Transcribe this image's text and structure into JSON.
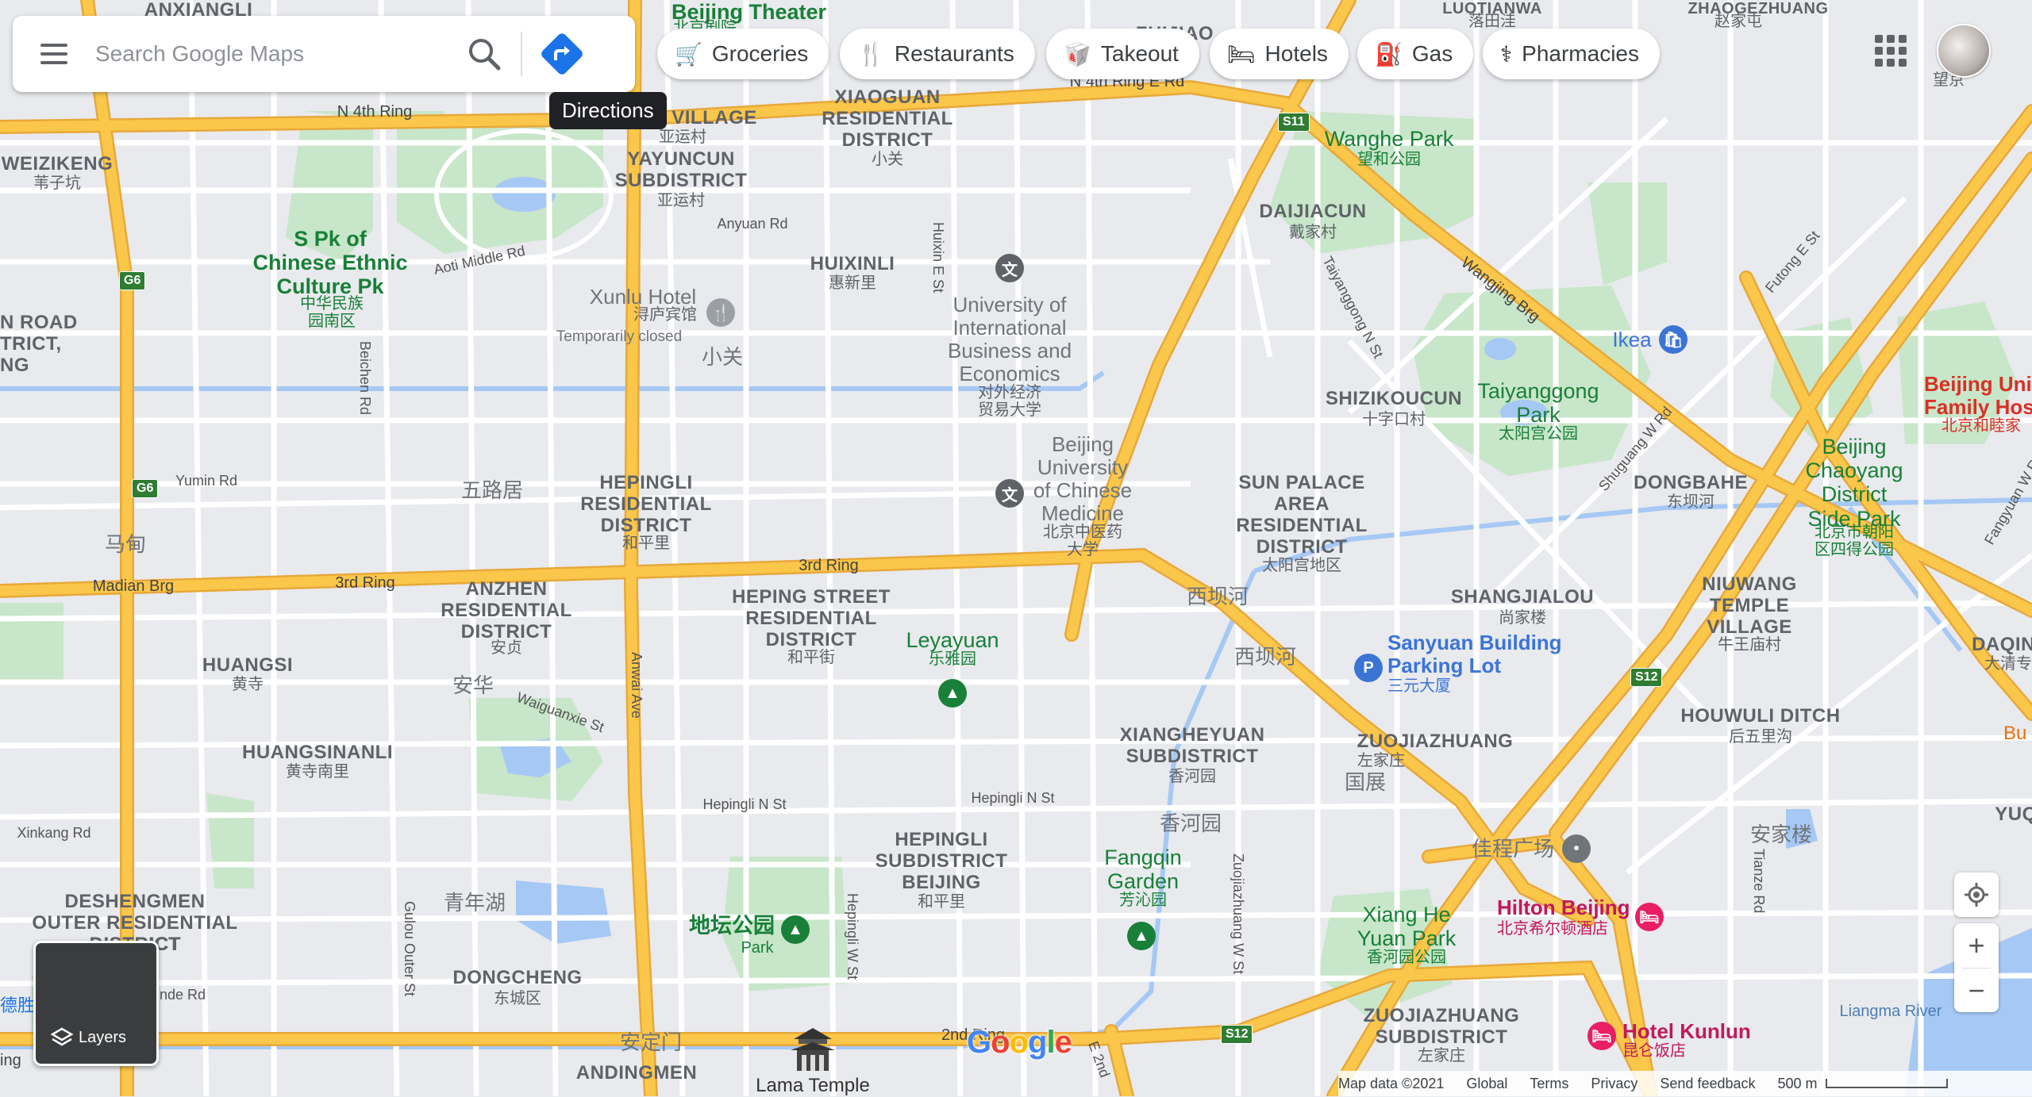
{
  "search": {
    "placeholder": "Search Google Maps"
  },
  "tooltip": {
    "directions": "Directions"
  },
  "chips": [
    {
      "icon": "cart-icon",
      "glyph": "🛒",
      "label": "Groceries"
    },
    {
      "icon": "fork-knife-icon",
      "glyph": "🍴",
      "label": "Restaurants"
    },
    {
      "icon": "takeout-icon",
      "glyph": "🥡",
      "label": "Takeout"
    },
    {
      "icon": "bed-icon",
      "glyph": "🛏",
      "label": "Hotels"
    },
    {
      "icon": "gas-pump-icon",
      "glyph": "⛽",
      "label": "Gas"
    },
    {
      "icon": "pharmacy-icon",
      "glyph": "⚕",
      "label": "Pharmacies"
    }
  ],
  "layers": {
    "label": "Layers"
  },
  "footer": {
    "map_data": "Map data ©2021",
    "global": "Global",
    "terms": "Terms",
    "privacy": "Privacy",
    "feedback": "Send feedback",
    "scale": "500 m"
  },
  "logo": "Google",
  "colors": {
    "road_major": "#fbc74a",
    "road_major_edge": "#e8a83a",
    "park": "#c8e6c9",
    "water": "#a6c8f5",
    "background": "#e8eaed",
    "highway_shield": "#2e7d32"
  },
  "labels": {
    "anxiangli": "ANXIANGLI",
    "beijing_theater": "Beijing Theater",
    "beijing_theater_zh": "北京剧院",
    "zhijiao": "ZHIJIAO",
    "luotianwa": "LUOTIANWA",
    "luotianwa_zh": "落田洼",
    "zhaogezhuang": "ZHAOGEZHUANG",
    "zhaogezhuang_zh": "赵家屯",
    "wangjing_zh": "望京",
    "n4th_ring_left": "N 4th Ring",
    "n4th_ring_right": "N 4th Ring E Rd",
    "yayuncun_village": "VILLAGE",
    "yayuncun_village_zh": "亚运村",
    "yayuncun": "YAYUNCUN\nSUBDISTRICT",
    "yayuncun_zh": "亚运村",
    "xiaoguan": "XIAOGUAN\nRESIDENTIAL\nDISTRICT",
    "xiaoguan_zh": "小关",
    "weizikeng": "WEIZIKENG",
    "weizikeng_zh": "苇子坑",
    "wanghe_park": "Wanghe Park",
    "wanghe_park_zh": "望和公园",
    "daijiacun": "DAIJIACUN",
    "daijiacun_zh": "戴家村",
    "culture_park": "S Pk of\nChinese Ethnic\nCulture Pk",
    "culture_park_zh": "中华民族\n园南区",
    "aoti_rd": "Aoti Middle Rd",
    "anyuan_rd": "Anyuan Rd",
    "huixinli": "HUIXINLI",
    "huixinli_zh": "惠新里",
    "huixin_e_st": "Huixin E St",
    "uibe": "University of\nInternational\nBusiness and\nEconomics",
    "uibe_zh": "对外经济\n贸易大学",
    "xunlu_hotel": "Xunlu Hotel",
    "xunlu_hotel_zh": "浔庐宾馆",
    "temporarily_closed": "Temporarily closed",
    "xiaoguan_zh2": "小关",
    "north_road": "N ROAD\nTRICT,\nNG",
    "beichen_rd": "Beichen Rd",
    "taiyanggong_n_st": "Taiyanggong N St",
    "wangjing_brg": "Wangjing Brg",
    "futong_e_st": "Futong E St",
    "ikea": "Ikea",
    "shizikoucun": "SHIZIKOUCUN",
    "shizikoucun_zh": "十字口村",
    "taiyanggong_park": "Taiyanggong\nPark",
    "taiyanggong_park_zh": "太阳宫公园",
    "beijing_united": "Beijing Uni\nFamily Hosp",
    "beijing_united_zh": "北京和睦家",
    "yumin_rd": "Yumin Rd",
    "wuluju_zh": "五路居",
    "hepingli": "HEPINGLI\nRESIDENTIAL\nDISTRICT",
    "hepingli_zh": "和平里",
    "bucm": "Beijing\nUniversity\nof Chinese\nMedicine",
    "bucm_zh": "北京中医药\n大学",
    "sun_palace": "SUN PALACE\nAREA\nRESIDENTIAL\nDISTRICT",
    "sun_palace_zh": "太阳宫地区",
    "shuguang_w_rd": "Shuguang W Rd",
    "dongbahe": "DONGBAHE",
    "dongbahe_zh": "东坝河",
    "chaoyang_side_park": "Beijing\nChaoyang\nDistrict\nSide Park",
    "chaoyang_side_park_zh": "北京市朝阳\n区四得公园",
    "fangyuan_w_rd": "Fangyuan W Rd",
    "madian_zh": "马甸",
    "madian_brg": "Madian Brg",
    "third_ring_left": "3rd Ring",
    "third_ring_mid": "3rd Ring",
    "anzhen": "ANZHEN\nRESIDENTIAL\nDISTRICT",
    "anzhen_zh": "安贞",
    "heping_street": "HEPING STREET\nRESIDENTIAL\nDISTRICT",
    "heping_street_zh": "和平街",
    "xibahe_zh": "西坝河",
    "xibahe_zh2": "西坝河",
    "shangjialou": "SHANGJIALOU",
    "shangjialou_zh": "尚家楼",
    "niuwang": "NIUWANG\nTEMPLE\nVILLAGE",
    "niuwang_zh": "牛王庙村",
    "leyayuan": "Leyayuan",
    "leyayuan_zh": "乐雅园",
    "sanyuan_parking": "Sanyuan Building\nParking Lot",
    "sanyuan_parking_zh": "三元大厦",
    "daqin": "DAQIN",
    "daqin_zh": "大清专",
    "huangsi": "HUANGSI",
    "huangsi_zh": "黄寺",
    "anwai_ave": "Anwai Ave",
    "anhua_zh": "安华",
    "waiguanxie_st": "Waiguanxie St",
    "xiangheyuan": "XIANGHEYUAN\nSUBDISTRICT",
    "xiangheyuan_zh": "香河园",
    "zuojiazhuang": "ZUOJIAZHUANG",
    "zuojiazhuang_zh": "左家庄",
    "guozhan_zh": "国展",
    "houwuli": "HOUWULI DITCH",
    "houwuli_zh": "后五里沟",
    "bu": "Bu",
    "huangsinanli": "HUANGSINANLI",
    "huangsinanli_zh": "黄寺南里",
    "hepingli_n_st": "Hepingli N St",
    "hepingli_n_st2": "Hepingli N St",
    "yuq": "YUQ",
    "xinkang_rd": "Xinkang Rd",
    "hepingli_sub": "HEPINGLI\nSUBDISTRICT\nBEIJING",
    "hepingli_sub_zh": "和平里",
    "xiangheyuan_zh2": "香河园",
    "jiacheng_zh": "佳程广场",
    "anjialou_zh": "安家楼",
    "fangqin": "Fangqin\nGarden",
    "fangqin_zh": "芳沁园",
    "zuojiazhuang_w_st": "Zuojiazhuang W St",
    "tianze_rd": "Tianze Rd",
    "deshengmen": "DESHENGMEN\nOUTER RESIDENTIAL\nDISTRICT",
    "deshengmen_tail": "ICT",
    "qingnianhu_zh": "青年湖",
    "ditan_park_zh": "地坛公园",
    "ditan_park": "Park",
    "gulou_outer_st": "Gulou Outer St",
    "hepingli_w_st": "Hepingli W St",
    "xiang_he_yuan_park": "Xiang He\nYuan Park",
    "xiang_he_yuan_park_zh": "香河园公园",
    "hilton": "Hilton Beijing",
    "hilton_zh": "北京希尔顿酒店",
    "inde_rd": "inde Rd",
    "desheng_zh": "德胜",
    "dongcheng": "DONGCHENG",
    "dongcheng_zh": "东城区",
    "zuojiazhuang_sub": "ZUOJIAZHUANG\nSUBDISTRICT",
    "zuojiazhuang_sub_zh": "左家庄",
    "hotel_kunlun": "Hotel Kunlun",
    "hotel_kunlun_zh": "昆仑饭店",
    "liangma_river": "Liangma River",
    "andingmen_zh": "安定门",
    "andingmen": "ANDINGMEN",
    "andingmen_sub_zh": "安定门",
    "lama_temple": "Lama Temple",
    "second_ring": "2nd Ring",
    "e2nd": "E 2nd",
    "ing": "ing"
  },
  "shields": {
    "s11": "S11",
    "g6a": "G6",
    "g6b": "G6",
    "s12a": "S12",
    "s12b": "S12"
  }
}
